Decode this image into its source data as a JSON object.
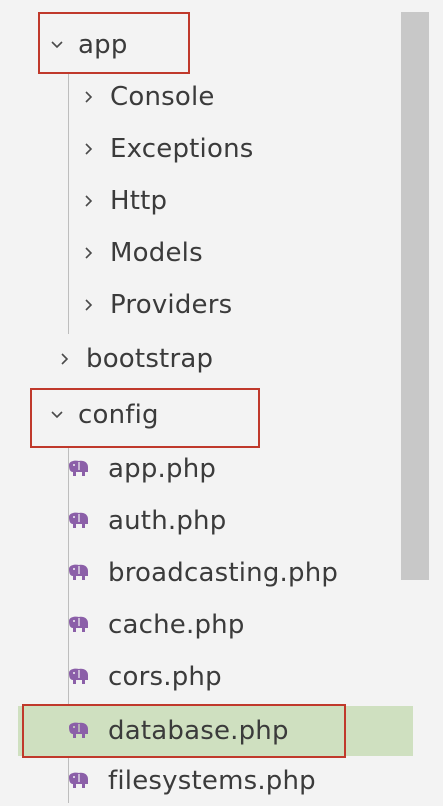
{
  "tree": {
    "app": {
      "label": "app",
      "expanded": true
    },
    "app_children": [
      {
        "label": "Console"
      },
      {
        "label": "Exceptions"
      },
      {
        "label": "Http"
      },
      {
        "label": "Models"
      },
      {
        "label": "Providers"
      }
    ],
    "bootstrap": {
      "label": "bootstrap"
    },
    "config": {
      "label": "config",
      "expanded": true
    },
    "config_files": [
      {
        "label": "app.php"
      },
      {
        "label": "auth.php"
      },
      {
        "label": "broadcasting.php"
      },
      {
        "label": "cache.php"
      },
      {
        "label": "cors.php"
      },
      {
        "label": "database.php",
        "selected": true
      },
      {
        "label": "filesystems.php"
      }
    ]
  },
  "icons": {
    "expanded": "chevron-down-icon",
    "collapsed": "chevron-right-icon",
    "php_file": "php-elephant-icon"
  },
  "colors": {
    "background": "#f3f3f3",
    "text": "#3b3b3b",
    "php_icon": "#8b5fa8",
    "highlight_border": "#c0392b",
    "selected_background": "#cfe0c0",
    "scrollbar_thumb": "#c8c8c8"
  }
}
